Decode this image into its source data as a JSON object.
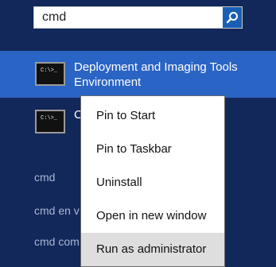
{
  "search": {
    "value": "cmd",
    "button_icon": "search-icon",
    "button_color": "#1a5fb4"
  },
  "results": [
    {
      "label_line1": "Deployment and Imaging Tools",
      "label_line2": "Environment",
      "icon": "command-prompt-icon",
      "selected": true
    },
    {
      "label_line1": "C",
      "icon": "command-prompt-icon",
      "selected": false
    }
  ],
  "suggestions": [
    "cmd",
    "cmd en v",
    "cmd com"
  ],
  "context_menu": {
    "items": [
      "Pin to Start",
      "Pin to Taskbar",
      "Uninstall",
      "Open in new window",
      "Run as administrator"
    ],
    "highlighted": "Run as administrator"
  },
  "icon_text": "C:\\>_",
  "colors": {
    "background": "#13285a",
    "selected_row": "#2a64c4",
    "menu_highlight": "#dedede"
  }
}
